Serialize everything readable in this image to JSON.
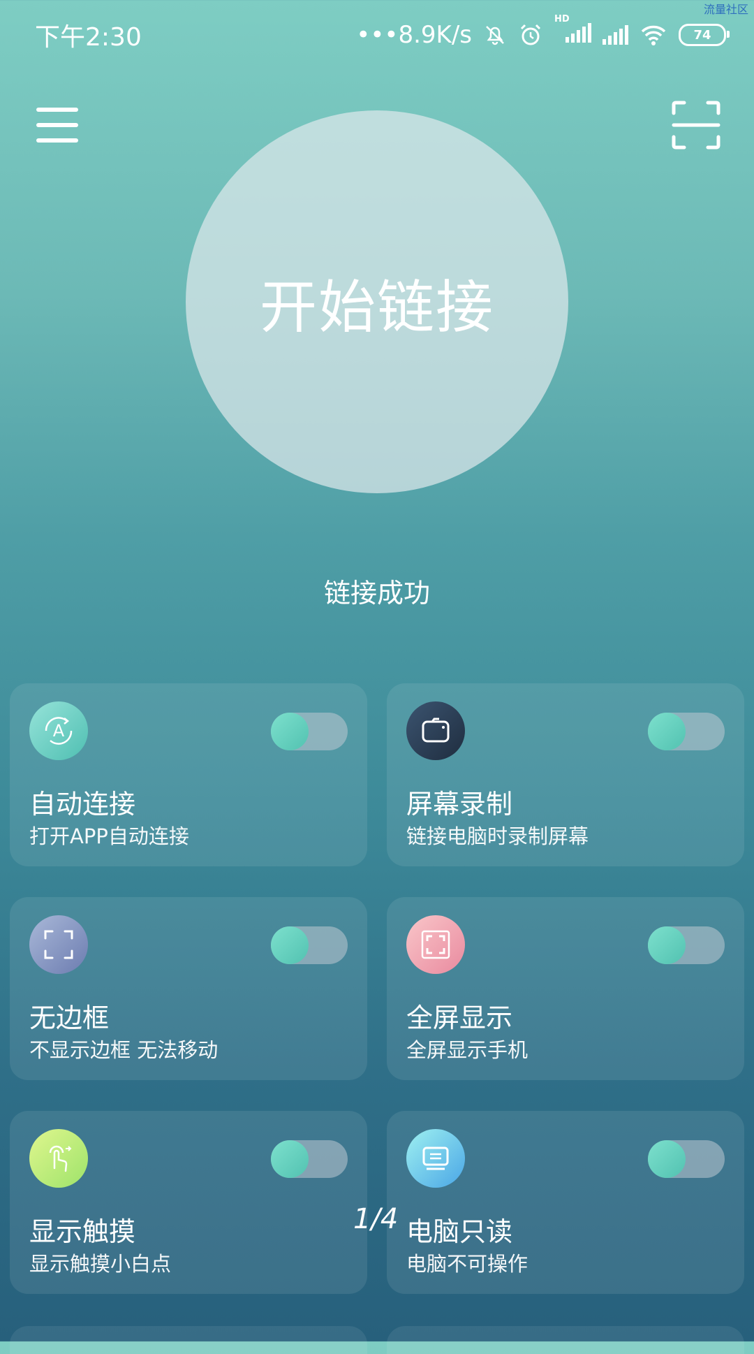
{
  "watermark": "流量社区",
  "statusbar": {
    "time": "下午2:30",
    "net": "•••8.9K/s",
    "hd": "HD",
    "battery": "74"
  },
  "main": {
    "button_label": "开始链接",
    "status": "链接成功"
  },
  "cards": [
    {
      "title": "自动连接",
      "subtitle": "打开APP自动连接",
      "icon": "auto-connect-icon",
      "on": true
    },
    {
      "title": "屏幕录制",
      "subtitle": "链接电脑时录制屏幕",
      "icon": "screen-record-icon",
      "on": true
    },
    {
      "title": "无边框",
      "subtitle": "不显示边框 无法移动",
      "icon": "frame-icon",
      "on": true
    },
    {
      "title": "全屏显示",
      "subtitle": "全屏显示手机",
      "icon": "fullscreen-icon",
      "on": true
    },
    {
      "title": "显示触摸",
      "subtitle": "显示触摸小白点",
      "icon": "touch-icon",
      "on": true
    },
    {
      "title": "电脑只读",
      "subtitle": "电脑不可操作",
      "icon": "monitor-icon",
      "on": true
    }
  ],
  "pager": "1/4",
  "colors": {
    "toggle_knob": "#5fd0be",
    "auto_icon": "#7fd8cf",
    "record_icon": "#2c3e55",
    "frame_icon": "#8a9ac6",
    "fullscreen_icon": "#f3a8b3",
    "touch_icon": "#c6ef7e",
    "monitor_icon": "#7ad6f0"
  }
}
